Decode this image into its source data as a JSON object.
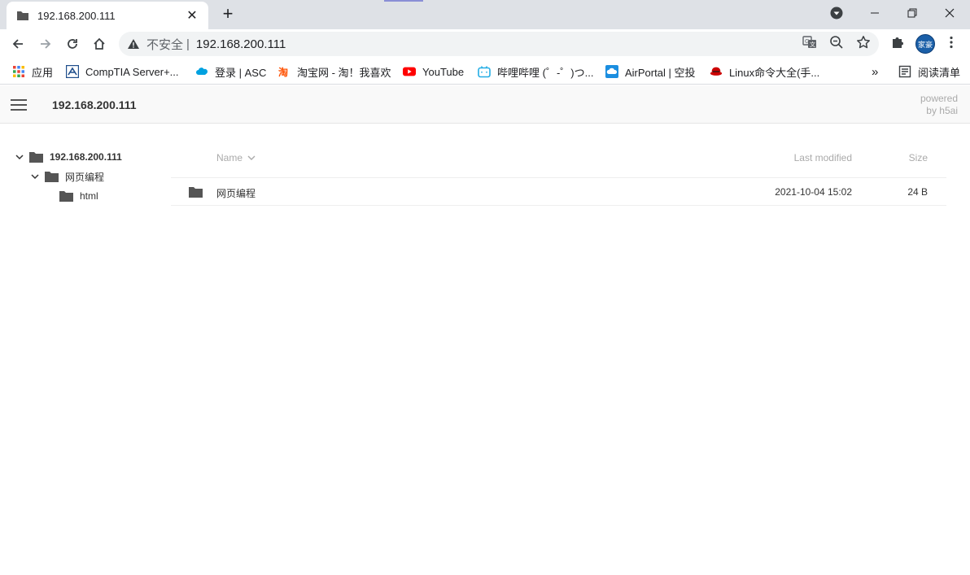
{
  "tab": {
    "title": "192.168.200.111",
    "close_label": "✕",
    "new_tab_label": "+"
  },
  "omnibox": {
    "security_label": "不安全",
    "separator": "|",
    "url": "192.168.200.111"
  },
  "profile": {
    "avatar_label": "家豪"
  },
  "bookmarks": [
    {
      "label": "应用",
      "icon": "apps-grid-icon"
    },
    {
      "label": "CompTIA Server+...",
      "icon": "comptia-icon"
    },
    {
      "label": "登录 | ASC",
      "icon": "salesforce-cloud-icon"
    },
    {
      "label": "淘宝网 - 淘！我喜欢",
      "icon": "taobao-icon"
    },
    {
      "label": "YouTube",
      "icon": "youtube-icon"
    },
    {
      "label": "哔哩哔哩 (゜-゜)つ...",
      "icon": "bilibili-icon"
    },
    {
      "label": "AirPortal | 空投",
      "icon": "airportal-icon"
    },
    {
      "label": "Linux命令大全(手...",
      "icon": "redhat-icon"
    }
  ],
  "bookmarks_overflow": "»",
  "reading_list": "阅读清单",
  "h5ai": {
    "crumb": "192.168.200.111",
    "powered_line1": "powered",
    "powered_line2": "by h5ai",
    "tree": [
      {
        "label": "192.168.200.111",
        "expanded": true
      },
      {
        "label": "网页编程",
        "expanded": true
      },
      {
        "label": "html",
        "expanded": false
      }
    ],
    "columns": {
      "name": "Name",
      "last_modified": "Last modified",
      "size": "Size"
    },
    "rows": [
      {
        "name": "网页编程",
        "last_modified": "2021-10-04 15:02",
        "size": "24 B"
      }
    ]
  },
  "colors": {
    "folder": "#555555",
    "youtube": "#ff0000",
    "bilibili": "#23ade5",
    "avatar": "#1a5fa8"
  }
}
